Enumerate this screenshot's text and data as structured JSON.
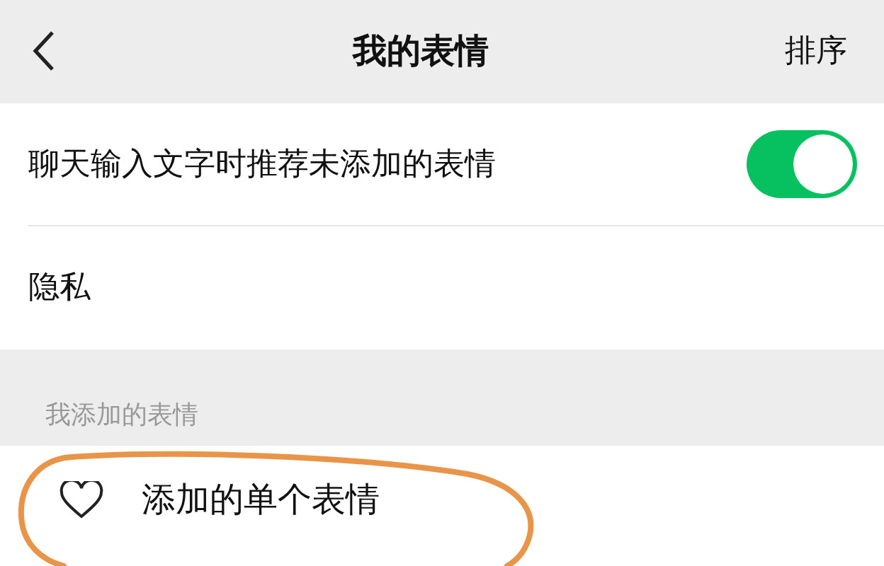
{
  "header": {
    "title": "我的表情",
    "action": "排序"
  },
  "settings": [
    {
      "kind": "toggle",
      "label": "聊天输入文字时推荐未添加的表情",
      "on": true
    },
    {
      "kind": "link",
      "label": "隐私"
    }
  ],
  "section": {
    "title": "我添加的表情"
  },
  "emoji_items": [
    {
      "label": "添加的单个表情"
    }
  ],
  "annotation": {
    "kind": "ellipse"
  }
}
